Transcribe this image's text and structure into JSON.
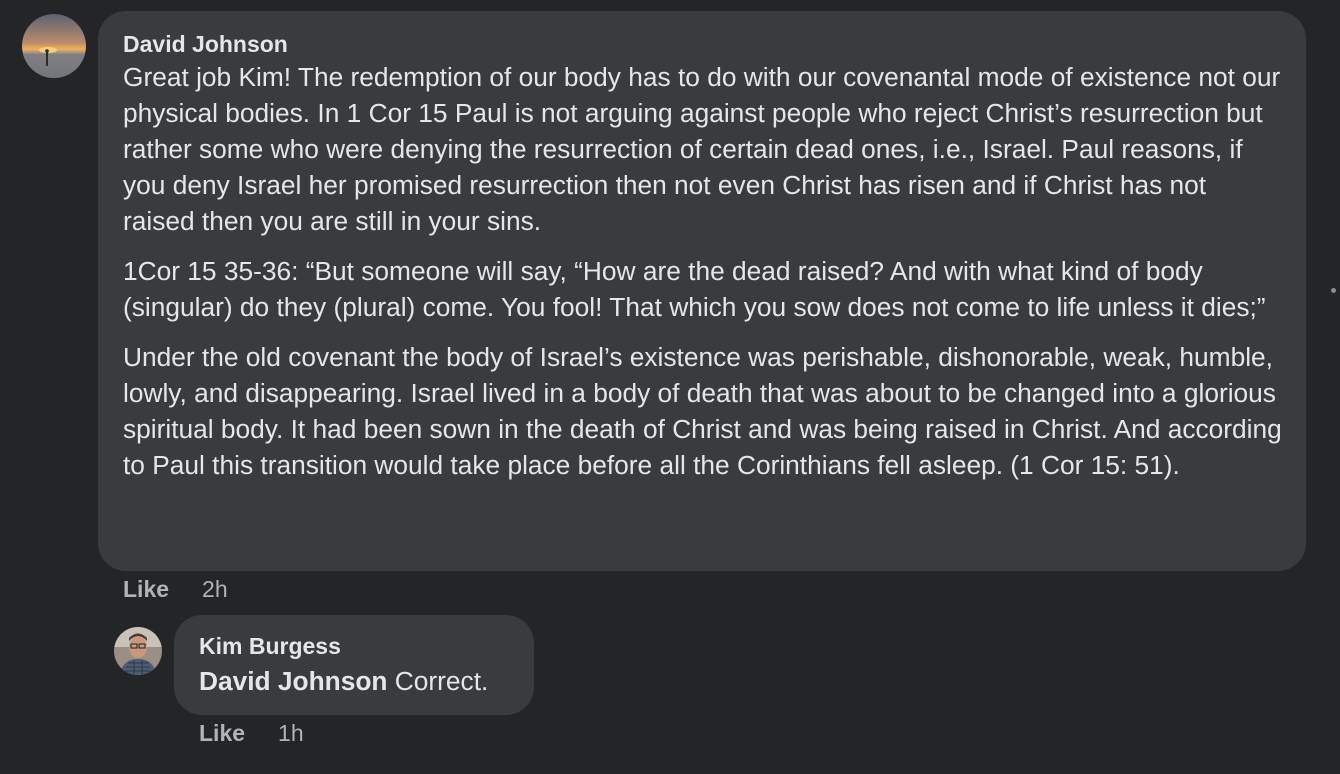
{
  "comment": {
    "author": "David Johnson",
    "paragraphs": [
      "Great job Kim! The redemption of our body has to do with our covenantal mode of existence not our physical bodies. In 1 Cor 15 Paul is not arguing against people who reject Christ’s resurrection but rather some who were denying the resurrection of certain dead ones, i.e., Israel. Paul reasons, if you deny Israel her promised resurrection then not even Christ has risen and if Christ has not raised then you are still in your sins.",
      "1Cor 15 35-36: “But someone will say, “How are the dead raised? And with what kind of body (singular) do they (plural) come. You fool! That which you sow does not come to life unless it dies;”",
      "Under the old covenant the body of Israel’s existence was perishable, dishonorable, weak, humble, lowly, and disappearing. Israel lived in a body of death that was about to be changed into a glorious spiritual body. It had been sown in the death of Christ and was being raised in Christ. And according to Paul this transition would take place before all the Corinthians fell asleep. (1 Cor 15: 51)."
    ],
    "like_label": "Like",
    "time": "2h"
  },
  "reply": {
    "author": "Kim Burgess",
    "mention": "David Johnson",
    "text": " Correct.",
    "like_label": "Like",
    "time": "1h"
  },
  "colors": {
    "background": "#242526",
    "bubble": "#3a3b3c",
    "text": "#e4e6eb",
    "secondary_text": "#b0b3b8"
  }
}
